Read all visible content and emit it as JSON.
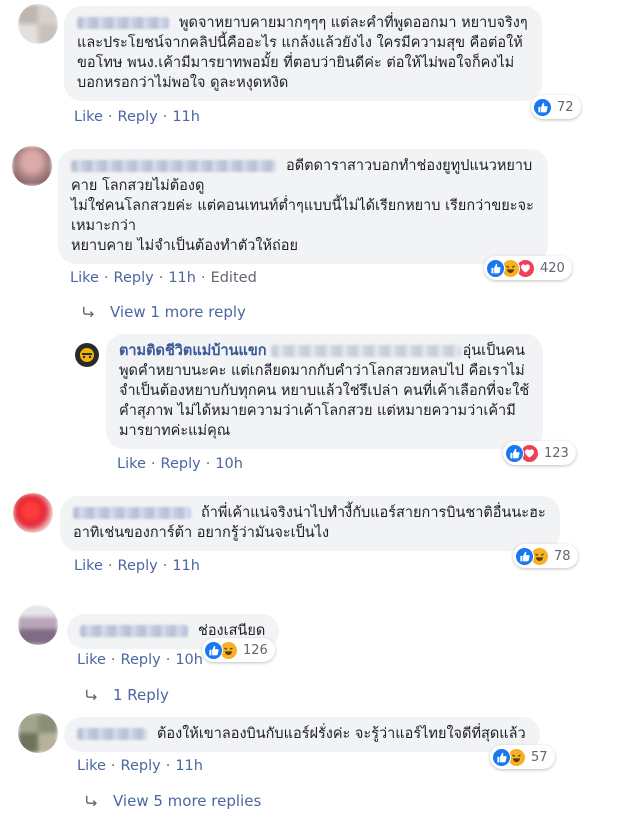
{
  "colors": {
    "link": "#4b67a1",
    "author": "#385898",
    "bubble": "#f2f3f5",
    "like": "#1877f2",
    "haha": "#f7b125",
    "love": "#f33e58"
  },
  "comments": [
    {
      "lines": [
        "พูดจาหยาบคายมากๆๆๆ แต่ละคำที่พูดออกมา หยาบจริงๆ",
        "และประโยชน์จากคลิปนี้คืออะไร แกล้งแล้วยังไง ใครมีความสุข คือต่อให้",
        "ขอโทษ พนง.เค้ามีมารยาทพอมั้ย ที่ตอบว่ายินดีค่ะ ต่อให้ไม่พอใจก็คงไม่",
        "บอกหรอกว่าไม่พอใจ ดูละหงุดหงิด"
      ],
      "like": "Like",
      "reply": "Reply",
      "time": "11h",
      "reactions": [
        "like-icon"
      ],
      "reaction_count": "72"
    },
    {
      "lines": [
        "อดีตดาราสาวบอกทำช่องยูทูปแนวหยาบ",
        "คาย โลกสวยไม่ต้องดู",
        "ไม่ใช่คนโลกสวยค่ะ แต่คอนเทนท์ต่ำๆแบบนี้ไม่ได้เรียกหยาบ เรียกว่าขยะจะ",
        "เหมาะกว่า",
        "หยาบคาย ไม่จำเป็นต้องทำตัวให้ถ่อย"
      ],
      "like": "Like",
      "reply": "Reply",
      "time": "11h",
      "edited": "Edited",
      "reactions": [
        "like-icon",
        "haha-icon",
        "love-icon"
      ],
      "reaction_count": "420",
      "view_more": "View 1 more reply"
    },
    {
      "author": "ตามติดชีวิตแม่บ้านแขก",
      "lines": [
        "อุ่นเป็นคน",
        "พูดคำหยาบนะคะ แต่เกลียดมากกับคำว่าโลกสวยหลบไป คือเราไม่",
        "จำเป็นต้องหยาบกับทุกคน หยาบแล้วใช่รึเปล่า คนที่เค้าเลือกที่จะใช้",
        "คำสุภาพ ไม่ได้หมายความว่าเค้าโลกสวย แต่หมายความว่าเค้ามี",
        "มารยาทค่ะแม่คุณ"
      ],
      "like": "Like",
      "reply": "Reply",
      "time": "10h",
      "reactions": [
        "like-icon",
        "love-icon"
      ],
      "reaction_count": "123"
    },
    {
      "lines": [
        "ถ้าพี่เค้าแน่จริงน่าไปทำงี้กับแอร์สายการบินชาติอื่นนะฮะ",
        "อาทิเช่นของการ์ต้า อยากรู้ว่ามันจะเป็นไง"
      ],
      "like": "Like",
      "reply": "Reply",
      "time": "11h",
      "reactions": [
        "like-icon",
        "haha-icon"
      ],
      "reaction_count": "78"
    },
    {
      "lines": [
        "ช่องเสนียด"
      ],
      "like": "Like",
      "reply": "Reply",
      "time": "10h",
      "reactions": [
        "like-icon",
        "haha-icon"
      ],
      "reaction_count": "126",
      "view_more": "1 Reply"
    },
    {
      "lines": [
        "ต้องให้เขาลองบินกับแอร์ฝรั่งค่ะ จะรู้ว่าแอร์ไทยใจดีที่สุดแล้ว"
      ],
      "like": "Like",
      "reply": "Reply",
      "time": "11h",
      "reactions": [
        "like-icon",
        "haha-icon"
      ],
      "reaction_count": "57",
      "view_more": "View 5 more replies"
    }
  ]
}
